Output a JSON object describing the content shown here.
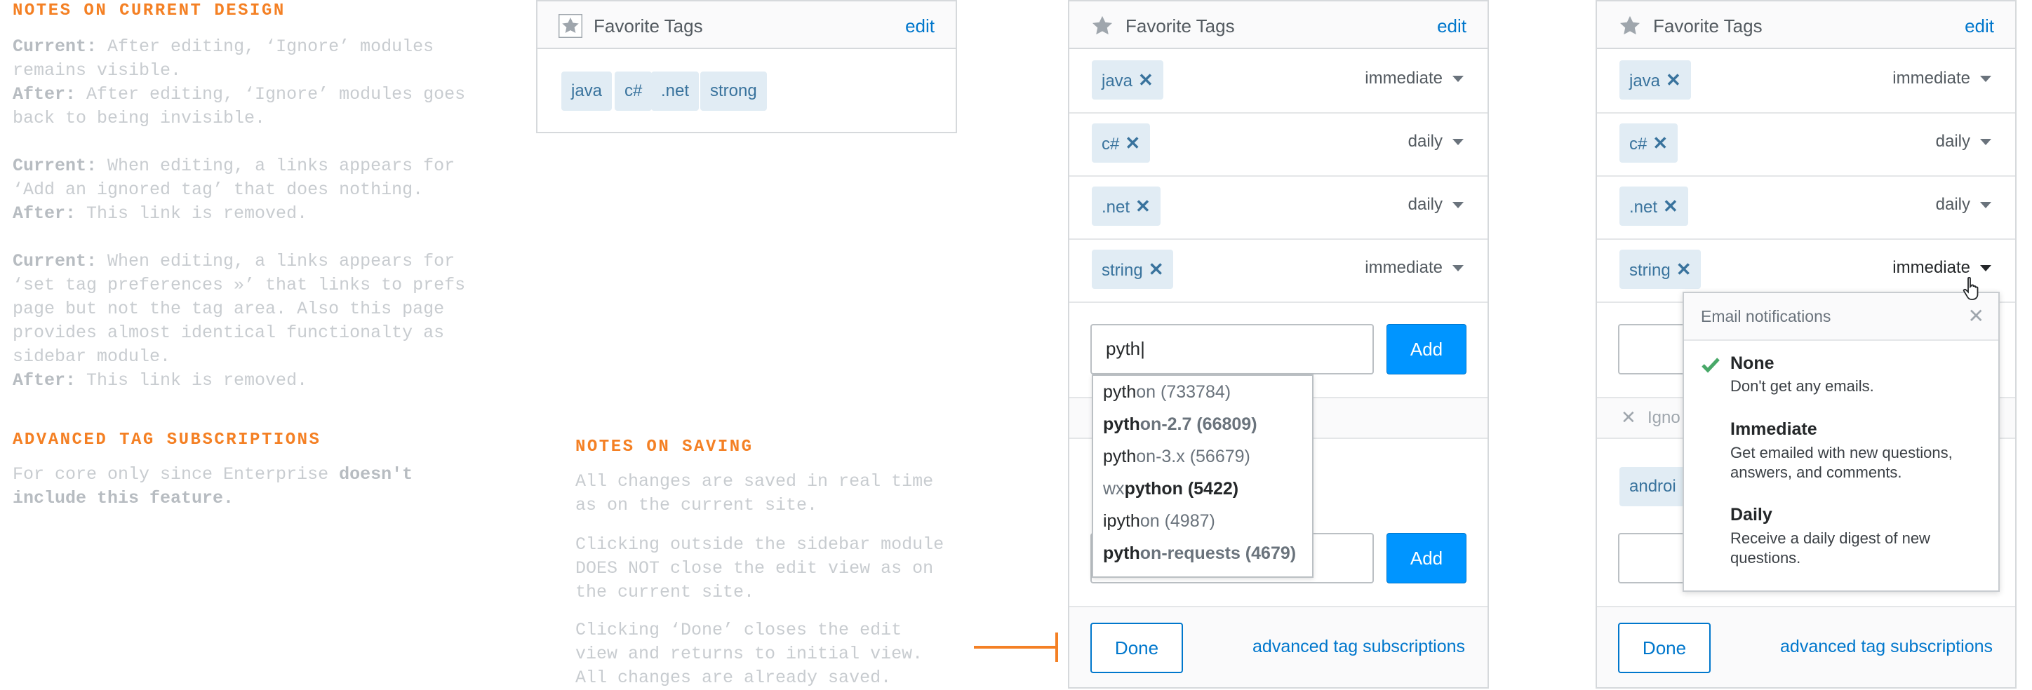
{
  "notes_current_design": {
    "heading": "NOTES ON CURRENT DESIGN",
    "items": [
      {
        "label": "Current:",
        "text": " After editing, ‘Ignore’ modules\nremains visible."
      },
      {
        "label": "After:",
        "text": " After editing, ‘Ignore’ modules goes\nback to being invisible."
      },
      {
        "label": "Current:",
        "text": " When editing, a links appears for\n‘Add an ignored tag’ that does nothing."
      },
      {
        "label": "After:",
        "text": " This link is removed."
      },
      {
        "label": "Current:",
        "text": " When editing, a links appears for\n‘set tag preferences »’ that links to prefs\npage but not the tag area. Also this page\nprovides almost identical functionalty as\nsidebar module."
      },
      {
        "label": "After:",
        "text": " This link is removed."
      }
    ]
  },
  "notes_advanced": {
    "heading": "ADVANCED TAG SUBSCRIPTIONS",
    "text_a": "For core only since Enterprise ",
    "text_b": "doesn't",
    "text_c": "include this feature."
  },
  "notes_saving": {
    "heading": "NOTES ON SAVING",
    "p1": "All changes are saved in real time\nas on the current site.",
    "p2": "Clicking outside the sidebar module\nDOES NOT close the edit view as on\nthe current site.",
    "p3": "Clicking ‘Done’ closes the edit\nview and returns to initial view.\nAll changes are already saved."
  },
  "panel1": {
    "title": "Favorite Tags",
    "edit": "edit",
    "tags": [
      "java",
      "c#",
      ".net",
      "strong"
    ]
  },
  "panel2": {
    "title": "Favorite Tags",
    "edit": "edit",
    "rows": [
      {
        "tag": "java",
        "freq": "immediate"
      },
      {
        "tag": "c#",
        "freq": "daily"
      },
      {
        "tag": ".net",
        "freq": "daily"
      },
      {
        "tag": "string",
        "freq": "immediate"
      }
    ],
    "input_value": "pyth|",
    "add_label": "Add",
    "add2_label": "Add",
    "suggestions": [
      {
        "match": "pyth",
        "rest": "on (733784)",
        "bold": false
      },
      {
        "match": "pyth",
        "rest": "on-2.7 (66809)",
        "bold": true
      },
      {
        "match": "pyth",
        "rest": "on-3.x (56679)",
        "bold": false
      },
      {
        "match": "wx",
        "rest": "python (5422)",
        "bold": true
      },
      {
        "match": "ipyth",
        "rest": "on (4987)",
        "bold": false
      },
      {
        "match": "pyth",
        "rest": "on-requests (4679)",
        "bold": true
      }
    ],
    "done_label": "Done",
    "advanced_link": "advanced tag subscriptions"
  },
  "panel3": {
    "title": "Favorite Tags",
    "edit": "edit",
    "rows": [
      {
        "tag": "java",
        "freq": "immediate"
      },
      {
        "tag": "c#",
        "freq": "daily"
      },
      {
        "tag": ".net",
        "freq": "daily"
      },
      {
        "tag": "string",
        "freq": "immediate"
      }
    ],
    "ignored_label_partial": "Igno",
    "ignored_tag_partial": "androi",
    "done_label": "Done",
    "advanced_link": "advanced tag subscriptions",
    "popover": {
      "title": "Email notifications",
      "options": [
        {
          "name": "None",
          "desc": "Don't get any emails.",
          "selected": true
        },
        {
          "name": "Immediate",
          "desc": "Get emailed with new questions,\nanswers, and comments.",
          "selected": false
        },
        {
          "name": "Daily",
          "desc": "Receive a daily digest of new\nquestions.",
          "selected": false
        }
      ]
    }
  },
  "colors": {
    "accent_orange": "#f48024",
    "link_blue": "#0077cc",
    "button_blue": "#0095ff",
    "tag_bg": "#e1ecf4",
    "tag_text": "#39739d",
    "check_green": "#48a868"
  }
}
